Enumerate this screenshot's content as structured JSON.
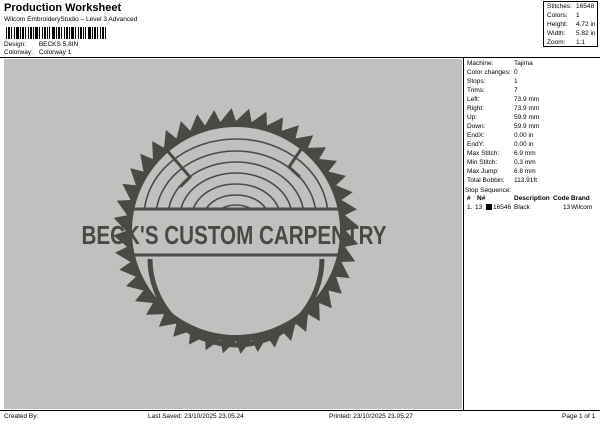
{
  "header": {
    "title": "Production Worksheet",
    "subtitle": "Wilcom EmbroideryStudio – Level 3 Advanced",
    "design_label": "Design:",
    "design_value": "BECKS 5,8IN",
    "colorway_label": "Colorway:",
    "colorway_value": "Colorway 1"
  },
  "stats": {
    "stitches_label": "Stitches:",
    "stitches": "16548",
    "colors_label": "Colors:",
    "colors": "1",
    "height_label": "Height:",
    "height": "4.72 in",
    "width_label": "Width:",
    "width": "5.82 in",
    "zoom_label": "Zoom:",
    "zoom": "1:1"
  },
  "design_preview": {
    "text": "BECK'S CUSTOM CARPENTRY",
    "thread_color": "#4a4a44",
    "background": "#c0c0c0"
  },
  "machine_info": [
    {
      "label": "Machine:",
      "value": "Tajima"
    },
    {
      "label": "Color changes:",
      "value": "0"
    },
    {
      "label": "Stops:",
      "value": "1"
    },
    {
      "label": "Trims:",
      "value": "7"
    },
    {
      "label": "Left:",
      "value": "73.9 mm"
    },
    {
      "label": "Right:",
      "value": "73.9 mm"
    },
    {
      "label": "Up:",
      "value": "59.9 mm"
    },
    {
      "label": "Down:",
      "value": "59.9 mm"
    },
    {
      "label": "EndX:",
      "value": "0.00 in"
    },
    {
      "label": "EndY:",
      "value": "0.00 in"
    },
    {
      "label": "Max Stitch:",
      "value": "6.9 mm"
    },
    {
      "label": "Min Stitch:",
      "value": "0.3 mm"
    },
    {
      "label": "Max Jump:",
      "value": "6.8 mm"
    },
    {
      "label": "Total Bobbin:",
      "value": "113.91ft"
    }
  ],
  "stop_sequence": {
    "title": "Stop Sequence:",
    "headers": {
      "num": "#",
      "n": "N#",
      "stitches": "",
      "description": "Description",
      "code": "Code",
      "brand": "Brand"
    },
    "rows": [
      {
        "num": "1.",
        "n": "13",
        "stitches": "16546",
        "description": "Black",
        "code": "13",
        "brand": "Wilcom",
        "swatch": "#000000"
      }
    ]
  },
  "footer": {
    "created_by": "Created By:",
    "last_saved": "Last Saved: 23/10/2025 23.05.24",
    "printed": "Printed: 23/10/2025 23.05.27",
    "page": "Page 1 of 1"
  }
}
